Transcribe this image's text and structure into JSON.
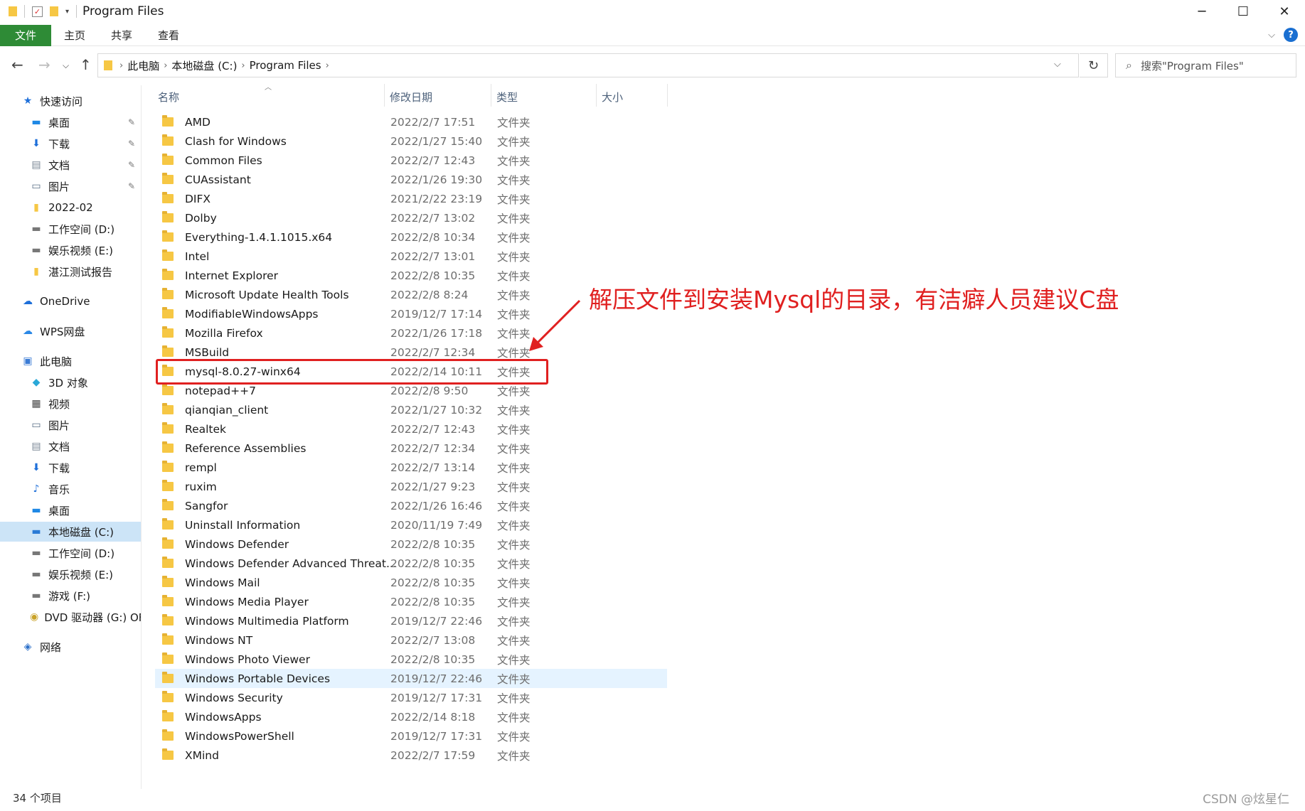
{
  "window": {
    "title": "Program Files",
    "minimize": "─",
    "maximize": "☐",
    "close": "✕"
  },
  "ribbon": {
    "file_tab": "文件",
    "tabs": [
      "主页",
      "共享",
      "查看"
    ],
    "help": "?"
  },
  "address": {
    "crumbs": [
      "此电脑",
      "本地磁盘 (C:)",
      "Program Files"
    ],
    "search_placeholder": "搜索\"Program Files\""
  },
  "nav": {
    "items": [
      {
        "label": "快速访问",
        "icon": "star-icon",
        "glyph": "★",
        "color": "#1e6fd9",
        "indent": 1,
        "pinned": false
      },
      {
        "label": "桌面",
        "icon": "desktop-icon",
        "glyph": "▬",
        "color": "#1e88e5",
        "indent": 2,
        "pinned": true
      },
      {
        "label": "下载",
        "icon": "download-icon",
        "glyph": "⬇",
        "color": "#1e6fd9",
        "indent": 2,
        "pinned": true
      },
      {
        "label": "文档",
        "icon": "document-icon",
        "glyph": "▤",
        "color": "#7a8796",
        "indent": 2,
        "pinned": true
      },
      {
        "label": "图片",
        "icon": "picture-icon",
        "glyph": "▭",
        "color": "#5a6f86",
        "indent": 2,
        "pinned": true
      },
      {
        "label": "2022-02",
        "icon": "folder-icon",
        "glyph": "▮",
        "color": "#f6c744",
        "indent": 2,
        "pinned": false
      },
      {
        "label": "工作空间 (D:)",
        "icon": "drive-icon",
        "glyph": "▬",
        "color": "#777777",
        "indent": 2,
        "pinned": false
      },
      {
        "label": "娱乐视频 (E:)",
        "icon": "drive-icon",
        "glyph": "▬",
        "color": "#777777",
        "indent": 2,
        "pinned": false
      },
      {
        "label": "湛江测试报告",
        "icon": "folder-icon",
        "glyph": "▮",
        "color": "#f6c744",
        "indent": 2,
        "pinned": false
      },
      {
        "label": "OneDrive",
        "icon": "cloud-icon",
        "glyph": "☁",
        "color": "#1e6fd9",
        "indent": 1,
        "pinned": false
      },
      {
        "label": "WPS网盘",
        "icon": "cloud-icon",
        "glyph": "☁",
        "color": "#2b88e6",
        "indent": 1,
        "pinned": false
      },
      {
        "label": "此电脑",
        "icon": "computer-icon",
        "glyph": "▣",
        "color": "#3a7bd5",
        "indent": 1,
        "pinned": false
      },
      {
        "label": "3D 对象",
        "icon": "cube-icon",
        "glyph": "◆",
        "color": "#2aa8d8",
        "indent": 2,
        "pinned": false
      },
      {
        "label": "视频",
        "icon": "video-icon",
        "glyph": "▦",
        "color": "#444444",
        "indent": 2,
        "pinned": false
      },
      {
        "label": "图片",
        "icon": "picture-icon",
        "glyph": "▭",
        "color": "#5a6f86",
        "indent": 2,
        "pinned": false
      },
      {
        "label": "文档",
        "icon": "document-icon",
        "glyph": "▤",
        "color": "#7a8796",
        "indent": 2,
        "pinned": false
      },
      {
        "label": "下载",
        "icon": "download-icon",
        "glyph": "⬇",
        "color": "#1e6fd9",
        "indent": 2,
        "pinned": false
      },
      {
        "label": "音乐",
        "icon": "music-icon",
        "glyph": "♪",
        "color": "#1e6fd9",
        "indent": 2,
        "pinned": false
      },
      {
        "label": "桌面",
        "icon": "desktop-icon",
        "glyph": "▬",
        "color": "#1e88e5",
        "indent": 2,
        "pinned": false
      },
      {
        "label": "本地磁盘 (C:)",
        "icon": "drive-c-icon",
        "glyph": "▬",
        "color": "#2a7bd6",
        "indent": 2,
        "pinned": false,
        "selected": true
      },
      {
        "label": "工作空间 (D:)",
        "icon": "drive-icon",
        "glyph": "▬",
        "color": "#777777",
        "indent": 2,
        "pinned": false
      },
      {
        "label": "娱乐视频 (E:)",
        "icon": "drive-icon",
        "glyph": "▬",
        "color": "#777777",
        "indent": 2,
        "pinned": false
      },
      {
        "label": "游戏 (F:)",
        "icon": "drive-icon",
        "glyph": "▬",
        "color": "#777777",
        "indent": 2,
        "pinned": false
      },
      {
        "label": "DVD 驱动器 (G:) OF",
        "icon": "dvd-icon",
        "glyph": "◉",
        "color": "#c9a227",
        "indent": 2,
        "pinned": false
      },
      {
        "label": "网络",
        "icon": "network-icon",
        "glyph": "◈",
        "color": "#2b6fc9",
        "indent": 1,
        "pinned": false
      }
    ]
  },
  "columns": {
    "name": "名称",
    "date": "修改日期",
    "type": "类型",
    "size": "大小"
  },
  "files": [
    {
      "name": "AMD",
      "date": "2022/2/7 17:51",
      "type": "文件夹"
    },
    {
      "name": "Clash for Windows",
      "date": "2022/1/27 15:40",
      "type": "文件夹"
    },
    {
      "name": "Common Files",
      "date": "2022/2/7 12:43",
      "type": "文件夹"
    },
    {
      "name": "CUAssistant",
      "date": "2022/1/26 19:30",
      "type": "文件夹"
    },
    {
      "name": "DIFX",
      "date": "2021/2/22 23:19",
      "type": "文件夹"
    },
    {
      "name": "Dolby",
      "date": "2022/2/7 13:02",
      "type": "文件夹"
    },
    {
      "name": "Everything-1.4.1.1015.x64",
      "date": "2022/2/8 10:34",
      "type": "文件夹"
    },
    {
      "name": "Intel",
      "date": "2022/2/7 13:01",
      "type": "文件夹"
    },
    {
      "name": "Internet Explorer",
      "date": "2022/2/8 10:35",
      "type": "文件夹"
    },
    {
      "name": "Microsoft Update Health Tools",
      "date": "2022/2/8 8:24",
      "type": "文件夹"
    },
    {
      "name": "ModifiableWindowsApps",
      "date": "2019/12/7 17:14",
      "type": "文件夹"
    },
    {
      "name": "Mozilla Firefox",
      "date": "2022/1/26 17:18",
      "type": "文件夹"
    },
    {
      "name": "MSBuild",
      "date": "2022/2/7 12:34",
      "type": "文件夹"
    },
    {
      "name": "mysql-8.0.27-winx64",
      "date": "2022/2/14 10:11",
      "type": "文件夹"
    },
    {
      "name": "notepad++7",
      "date": "2022/2/8 9:50",
      "type": "文件夹"
    },
    {
      "name": "qianqian_client",
      "date": "2022/1/27 10:32",
      "type": "文件夹"
    },
    {
      "name": "Realtek",
      "date": "2022/2/7 12:43",
      "type": "文件夹"
    },
    {
      "name": "Reference Assemblies",
      "date": "2022/2/7 12:34",
      "type": "文件夹"
    },
    {
      "name": "rempl",
      "date": "2022/2/7 13:14",
      "type": "文件夹"
    },
    {
      "name": "ruxim",
      "date": "2022/1/27 9:23",
      "type": "文件夹"
    },
    {
      "name": "Sangfor",
      "date": "2022/1/26 16:46",
      "type": "文件夹"
    },
    {
      "name": "Uninstall Information",
      "date": "2020/11/19 7:49",
      "type": "文件夹"
    },
    {
      "name": "Windows Defender",
      "date": "2022/2/8 10:35",
      "type": "文件夹"
    },
    {
      "name": "Windows Defender Advanced Threat...",
      "date": "2022/2/8 10:35",
      "type": "文件夹"
    },
    {
      "name": "Windows Mail",
      "date": "2022/2/8 10:35",
      "type": "文件夹"
    },
    {
      "name": "Windows Media Player",
      "date": "2022/2/8 10:35",
      "type": "文件夹"
    },
    {
      "name": "Windows Multimedia Platform",
      "date": "2019/12/7 22:46",
      "type": "文件夹"
    },
    {
      "name": "Windows NT",
      "date": "2022/2/7 13:08",
      "type": "文件夹"
    },
    {
      "name": "Windows Photo Viewer",
      "date": "2022/2/8 10:35",
      "type": "文件夹"
    },
    {
      "name": "Windows Portable Devices",
      "date": "2019/12/7 22:46",
      "type": "文件夹",
      "hovered": true
    },
    {
      "name": "Windows Security",
      "date": "2019/12/7 17:31",
      "type": "文件夹"
    },
    {
      "name": "WindowsApps",
      "date": "2022/2/14 8:18",
      "type": "文件夹"
    },
    {
      "name": "WindowsPowerShell",
      "date": "2019/12/7 17:31",
      "type": "文件夹"
    },
    {
      "name": "XMind",
      "date": "2022/2/7 17:59",
      "type": "文件夹"
    }
  ],
  "annotation": {
    "text": "解压文件到安装Mysql的目录，有洁癖人员建议C盘",
    "color": "#e02020"
  },
  "status": {
    "count": "34 个项目",
    "watermark": "CSDN @炫星仁"
  }
}
